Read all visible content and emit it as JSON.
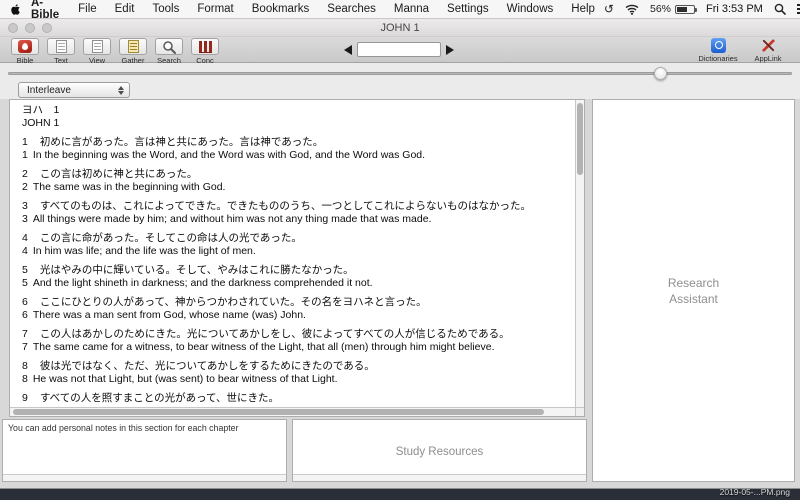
{
  "menu_bar": {
    "app_name": "A-Bible",
    "items": [
      "File",
      "Edit",
      "Tools",
      "Format",
      "Bookmarks",
      "Searches",
      "Manna",
      "Settings",
      "Windows",
      "Help"
    ],
    "status": {
      "battery_percent": "56%",
      "datetime": "Fri 3:53 PM"
    }
  },
  "window": {
    "title": "JOHN 1",
    "toolbar": {
      "buttons": [
        {
          "label": "Bible"
        },
        {
          "label": "Text"
        },
        {
          "label": "View"
        },
        {
          "label": "Gather"
        },
        {
          "label": "Search"
        },
        {
          "label": "Conc"
        }
      ],
      "verse_input": {
        "value": ""
      },
      "right_buttons": [
        {
          "label": "Dictionaries"
        },
        {
          "label": "AppLink"
        }
      ]
    },
    "view_mode_dropdown": {
      "selected": "Interleave"
    },
    "bible_text": {
      "heading_jp": "ヨハ　1",
      "heading_en": "JOHN 1",
      "verses": [
        {
          "num": "1",
          "jp": "初めに言があった。言は神と共にあった。言は神であった。",
          "en": "In the beginning was the Word, and the Word was with God, and the Word was God."
        },
        {
          "num": "2",
          "jp": "この言は初めに神と共にあった。",
          "en": "The same was in the beginning with God."
        },
        {
          "num": "3",
          "jp": "すべてのものは、これによってできた。できたもののうち、一つとしてこれによらないものはなかった。",
          "en": "All things were made by him; and without him was not any thing made that was made."
        },
        {
          "num": "4",
          "jp": "この言に命があった。そしてこの命は人の光であった。",
          "en": "In him was life; and the life was the light of men."
        },
        {
          "num": "5",
          "jp": "光はやみの中に輝いている。そして、やみはこれに勝たなかった。",
          "en": "And the light shineth in darkness; and the darkness comprehended it not."
        },
        {
          "num": "6",
          "jp": "ここにひとりの人があって、神からつかわされていた。その名をヨハネと言った。",
          "en": "There was a man sent from God, whose name (was) John."
        },
        {
          "num": "7",
          "jp": "この人はあかしのためにきた。光についてあかしをし、彼によってすべての人が信じるためである。",
          "en": "The same came for a witness, to bear witness of the Light, that all (men) through him might believe."
        },
        {
          "num": "8",
          "jp": "彼は光ではなく、ただ、光についてあかしをするためにきたのである。",
          "en": "He was not that Light, but (was sent) to bear witness of that Light."
        },
        {
          "num": "9",
          "jp": "すべての人を照すまことの光があって、世にきた。",
          "en": ""
        }
      ]
    },
    "research_panel": {
      "label": "Research Assistant"
    },
    "notes_panel": {
      "text": "You can add personal notes in this section for each chapter"
    },
    "study_panel": {
      "label": "Study Resources"
    }
  },
  "desktop": {
    "wallpaper_filename": "2019-05-...PM.png"
  }
}
